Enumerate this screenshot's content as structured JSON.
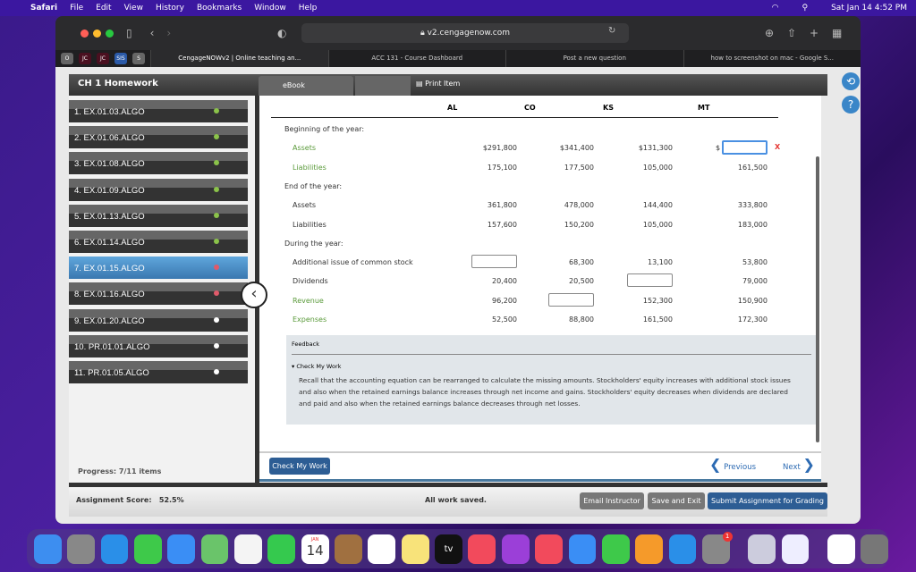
{
  "menubar": {
    "app": "Safari",
    "items": [
      "File",
      "Edit",
      "View",
      "History",
      "Bookmarks",
      "Window",
      "Help"
    ],
    "clock": "Sat Jan 14  4:52 PM"
  },
  "browser": {
    "url": "v2.cengagenow.com",
    "pinned": [
      "O",
      "JC",
      "JC",
      "SIS",
      "S"
    ],
    "tabs": [
      "CengageNOWv2 | Online teaching an...",
      "ACC 131 - Course Dashboard",
      "Post a new question",
      "how to screenshot on mac - Google S..."
    ]
  },
  "header": {
    "title": "CH 1 Homework",
    "ebook": "eBook",
    "print": "Print Item"
  },
  "sidebar": {
    "items": [
      {
        "label": "1. EX.01.03.ALGO",
        "status": "correct"
      },
      {
        "label": "2. EX.01.06.ALGO",
        "status": "correct"
      },
      {
        "label": "3. EX.01.08.ALGO",
        "status": "correct"
      },
      {
        "label": "4. EX.01.09.ALGO",
        "status": "correct"
      },
      {
        "label": "5. EX.01.13.ALGO",
        "status": "correct"
      },
      {
        "label": "6. EX.01.14.ALGO",
        "status": "correct"
      },
      {
        "label": "7. EX.01.15.ALGO",
        "status": "incorrect"
      },
      {
        "label": "8. EX.01.16.ALGO",
        "status": "incorrect"
      },
      {
        "label": "9. EX.01.20.ALGO",
        "status": "unanswered"
      },
      {
        "label": "10. PR.01.01.ALGO",
        "status": "unanswered"
      },
      {
        "label": "11. PR.01.05.ALGO",
        "status": "unanswered"
      }
    ],
    "progress": "Progress:  7/11 items"
  },
  "table": {
    "columns": [
      "AL",
      "CO",
      "KS",
      "MT"
    ],
    "rows": [
      {
        "label": "Beginning of the year:",
        "section": true
      },
      {
        "label": "Assets",
        "green": true,
        "values": [
          "$291,800",
          "$341,400",
          "$131,300",
          null
        ],
        "prefix_mt": "$"
      },
      {
        "label": "Liabilities",
        "green": true,
        "values": [
          "175,100",
          "177,500",
          "105,000",
          "161,500"
        ]
      },
      {
        "label": "End of the year:",
        "section": true
      },
      {
        "label": "Assets",
        "values": [
          "361,800",
          "478,000",
          "144,400",
          "333,800"
        ]
      },
      {
        "label": "Liabilities",
        "values": [
          "157,600",
          "150,200",
          "105,000",
          "183,000"
        ]
      },
      {
        "label": "During the year:",
        "section": true
      },
      {
        "label": "Additional issue of common stock",
        "values": [
          null,
          "68,300",
          "13,100",
          "53,800"
        ]
      },
      {
        "label": "Dividends",
        "values": [
          "20,400",
          "20,500",
          null,
          "79,000"
        ]
      },
      {
        "label": "Revenue",
        "green": true,
        "values": [
          "96,200",
          null,
          "152,300",
          "150,900"
        ]
      },
      {
        "label": "Expenses",
        "green": true,
        "values": [
          "52,500",
          "88,800",
          "161,500",
          "172,300"
        ]
      }
    ],
    "error_mark": "X"
  },
  "feedback": {
    "title": "Feedback",
    "toggle": "Check My Work",
    "text": "Recall that the accounting equation can be rearranged to calculate the missing amounts. Stockholders' equity increases with additional stock issues and also when the retained earnings balance increases through net income and gains. Stockholders' equity decreases when dividends are declared and paid and also when the retained earnings balance decreases through net losses."
  },
  "nav": {
    "check": "Check My Work",
    "previous": "Previous",
    "next": "Next"
  },
  "footer": {
    "score": "Assignment Score:   52.5%",
    "saved": "All work saved.",
    "email": "Email Instructor",
    "save": "Save and Exit",
    "submit": "Submit Assignment for Grading"
  },
  "dock": {
    "calendar_month": "JAN",
    "calendar_day": "14",
    "tv": "tv",
    "badge": "1"
  },
  "colors": {
    "accent": "#2d5d94",
    "correct": "#8bc34a",
    "incorrect": "#e05a6a",
    "error": "#e53935"
  }
}
